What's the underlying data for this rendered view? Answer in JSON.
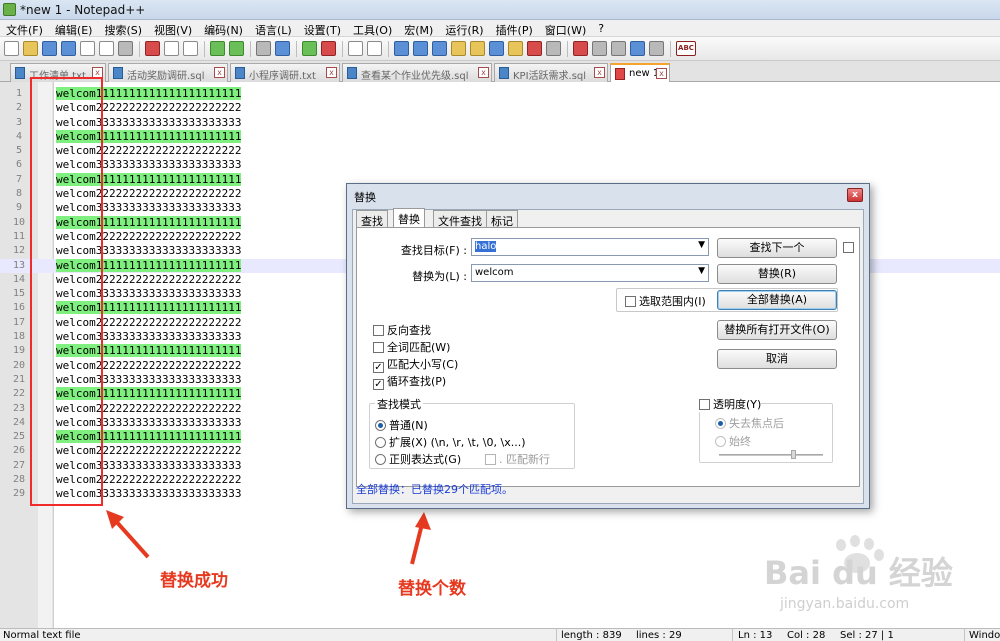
{
  "window": {
    "title": "*new 1 - Notepad++"
  },
  "menu": [
    "文件(F)",
    "编辑(E)",
    "搜索(S)",
    "视图(V)",
    "编码(N)",
    "语言(L)",
    "设置(T)",
    "工具(O)",
    "宏(M)",
    "运行(R)",
    "插件(P)",
    "窗口(W)",
    "?"
  ],
  "toolbar": {
    "spellcheck_label": "ABC"
  },
  "tabs": [
    {
      "label": "工作清单.txt"
    },
    {
      "label": "活动奖励调研.sql"
    },
    {
      "label": "小程序调研.txt"
    },
    {
      "label": "查看某个作业优先级.sql"
    },
    {
      "label": "KPI活跃需求.sql"
    },
    {
      "label": "new 1"
    }
  ],
  "editor": {
    "lines": [
      {
        "num": "1",
        "prefix": "welcom",
        "rest": "1111111111111111111111"
      },
      {
        "num": "2",
        "prefix": "welcom",
        "rest": "2222222222222222222222"
      },
      {
        "num": "3",
        "prefix": "welcom",
        "rest": "3333333333333333333333"
      },
      {
        "num": "4",
        "prefix": "welcom",
        "rest": "1111111111111111111111"
      },
      {
        "num": "5",
        "prefix": "welcom",
        "rest": "2222222222222222222222"
      },
      {
        "num": "6",
        "prefix": "welcom",
        "rest": "3333333333333333333333"
      },
      {
        "num": "7",
        "prefix": "welcom",
        "rest": "1111111111111111111111"
      },
      {
        "num": "8",
        "prefix": "welcom",
        "rest": "2222222222222222222222"
      },
      {
        "num": "9",
        "prefix": "welcom",
        "rest": "3333333333333333333333"
      },
      {
        "num": "10",
        "prefix": "welcom",
        "rest": "1111111111111111111111"
      },
      {
        "num": "11",
        "prefix": "welcom",
        "rest": "2222222222222222222222"
      },
      {
        "num": "12",
        "prefix": "welcom",
        "rest": "3333333333333333333333"
      },
      {
        "num": "13",
        "prefix": "welcom",
        "rest": "1111111111111111111111"
      },
      {
        "num": "14",
        "prefix": "welcom",
        "rest": "2222222222222222222222"
      },
      {
        "num": "15",
        "prefix": "welcom",
        "rest": "3333333333333333333333"
      },
      {
        "num": "16",
        "prefix": "welcom",
        "rest": "1111111111111111111111"
      },
      {
        "num": "17",
        "prefix": "welcom",
        "rest": "2222222222222222222222"
      },
      {
        "num": "18",
        "prefix": "welcom",
        "rest": "3333333333333333333333"
      },
      {
        "num": "19",
        "prefix": "welcom",
        "rest": "1111111111111111111111"
      },
      {
        "num": "20",
        "prefix": "welcom",
        "rest": "2222222222222222222222"
      },
      {
        "num": "21",
        "prefix": "welcom",
        "rest": "3333333333333333333333"
      },
      {
        "num": "22",
        "prefix": "welcom",
        "rest": "1111111111111111111111"
      },
      {
        "num": "23",
        "prefix": "welcom",
        "rest": "2222222222222222222222"
      },
      {
        "num": "24",
        "prefix": "welcom",
        "rest": "3333333333333333333333"
      },
      {
        "num": "25",
        "prefix": "welcom",
        "rest": "1111111111111111111111"
      },
      {
        "num": "26",
        "prefix": "welcom",
        "rest": "2222222222222222222222"
      },
      {
        "num": "27",
        "prefix": "welcom",
        "rest": "3333333333333333333333"
      },
      {
        "num": "28",
        "prefix": "welcom",
        "rest": "2222222222222222222222"
      },
      {
        "num": "29",
        "prefix": "welcom",
        "rest": "3333333333333333333333"
      }
    ],
    "current_line": "13"
  },
  "dialog": {
    "title": "替换",
    "close_label": "x",
    "tabs": [
      "查找",
      "替换",
      "文件查找",
      "标记"
    ],
    "find_label": "查找目标(F) :",
    "find_value": "halo",
    "replace_label": "替换为(L) :",
    "replace_value": "welcom",
    "buttons": {
      "find_next": "查找下一个",
      "replace": "替换(R)",
      "replace_all": "全部替换(A)",
      "replace_all_open": "替换所有打开文件(O)",
      "cancel": "取消"
    },
    "in_selection": "选取范围内(I)",
    "options": {
      "backward": "反向查找",
      "whole_word": "全词匹配(W)",
      "match_case": "匹配大小写(C)",
      "wrap": "循环查找(P)"
    },
    "search_mode": {
      "title": "查找模式",
      "normal": "普通(N)",
      "extended": "扩展(X) (\\n, \\r, \\t, \\0, \\x...)",
      "regex": "正则表达式(G)",
      "dot_newline": ". 匹配新行"
    },
    "transparency": {
      "title": "透明度(Y)",
      "on_lose_focus": "失去焦点后",
      "always": "始终"
    },
    "status_message": "全部替换：已替换29个匹配项。"
  },
  "annotations": {
    "replace_success": "替换成功",
    "replace_count": "替换个数"
  },
  "statusbar": {
    "file_type": "Normal text file",
    "length": "length : 839",
    "lines": "lines : 29",
    "ln": "Ln : 13",
    "col": "Col : 28",
    "sel": "Sel : 27 | 1",
    "eol": "Windo"
  },
  "watermark": {
    "brand": "Bai du 经验",
    "url": "jingyan.baidu.com"
  },
  "colors": {
    "highlight": "#7ff07f",
    "annotation": "#ef2b2b",
    "status_text": "#1a3cd6"
  }
}
